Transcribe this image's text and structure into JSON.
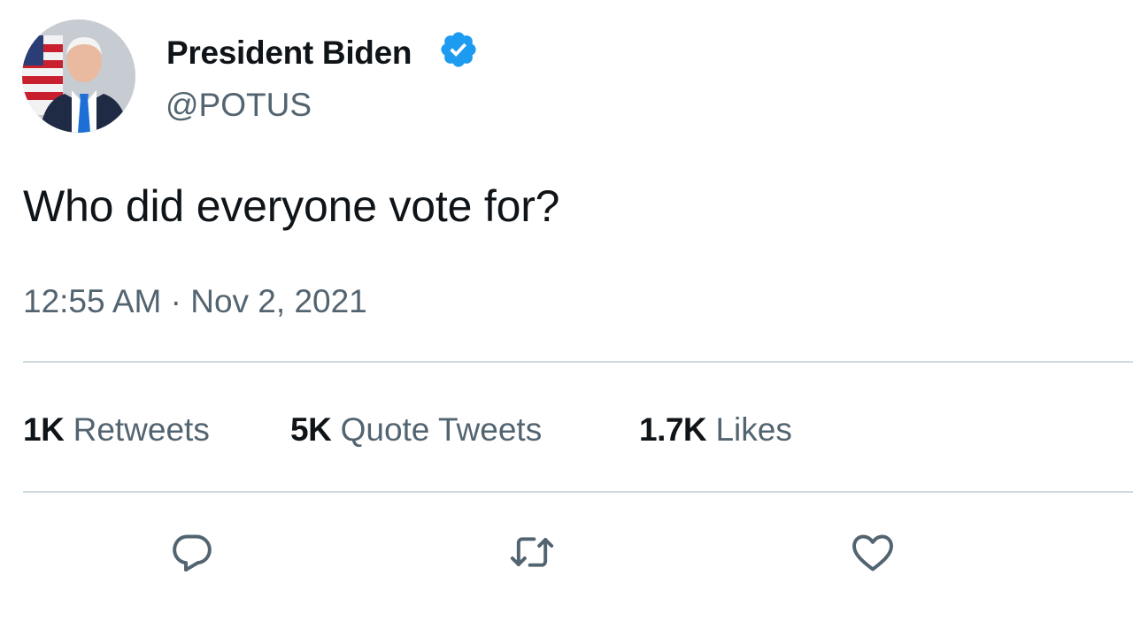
{
  "tweet": {
    "author": {
      "display_name": "President Biden",
      "handle": "@POTUS",
      "verified": true
    },
    "text": "Who did everyone vote for?",
    "time": "12:55 AM",
    "separator": "·",
    "date": "Nov 2, 2021",
    "stats": {
      "retweets": {
        "count": "1K",
        "label": "Retweets"
      },
      "quotes": {
        "count": "5K",
        "label": "Quote Tweets"
      },
      "likes": {
        "count": "1.7K",
        "label": "Likes"
      }
    },
    "actions": [
      {
        "icon": "reply-icon"
      },
      {
        "icon": "retweet-icon"
      },
      {
        "icon": "like-icon"
      }
    ]
  },
  "colors": {
    "primary_text": "#0f1419",
    "secondary_text": "#536471",
    "divider": "#cfd9de",
    "verified_badge": "#1d9bf0"
  }
}
